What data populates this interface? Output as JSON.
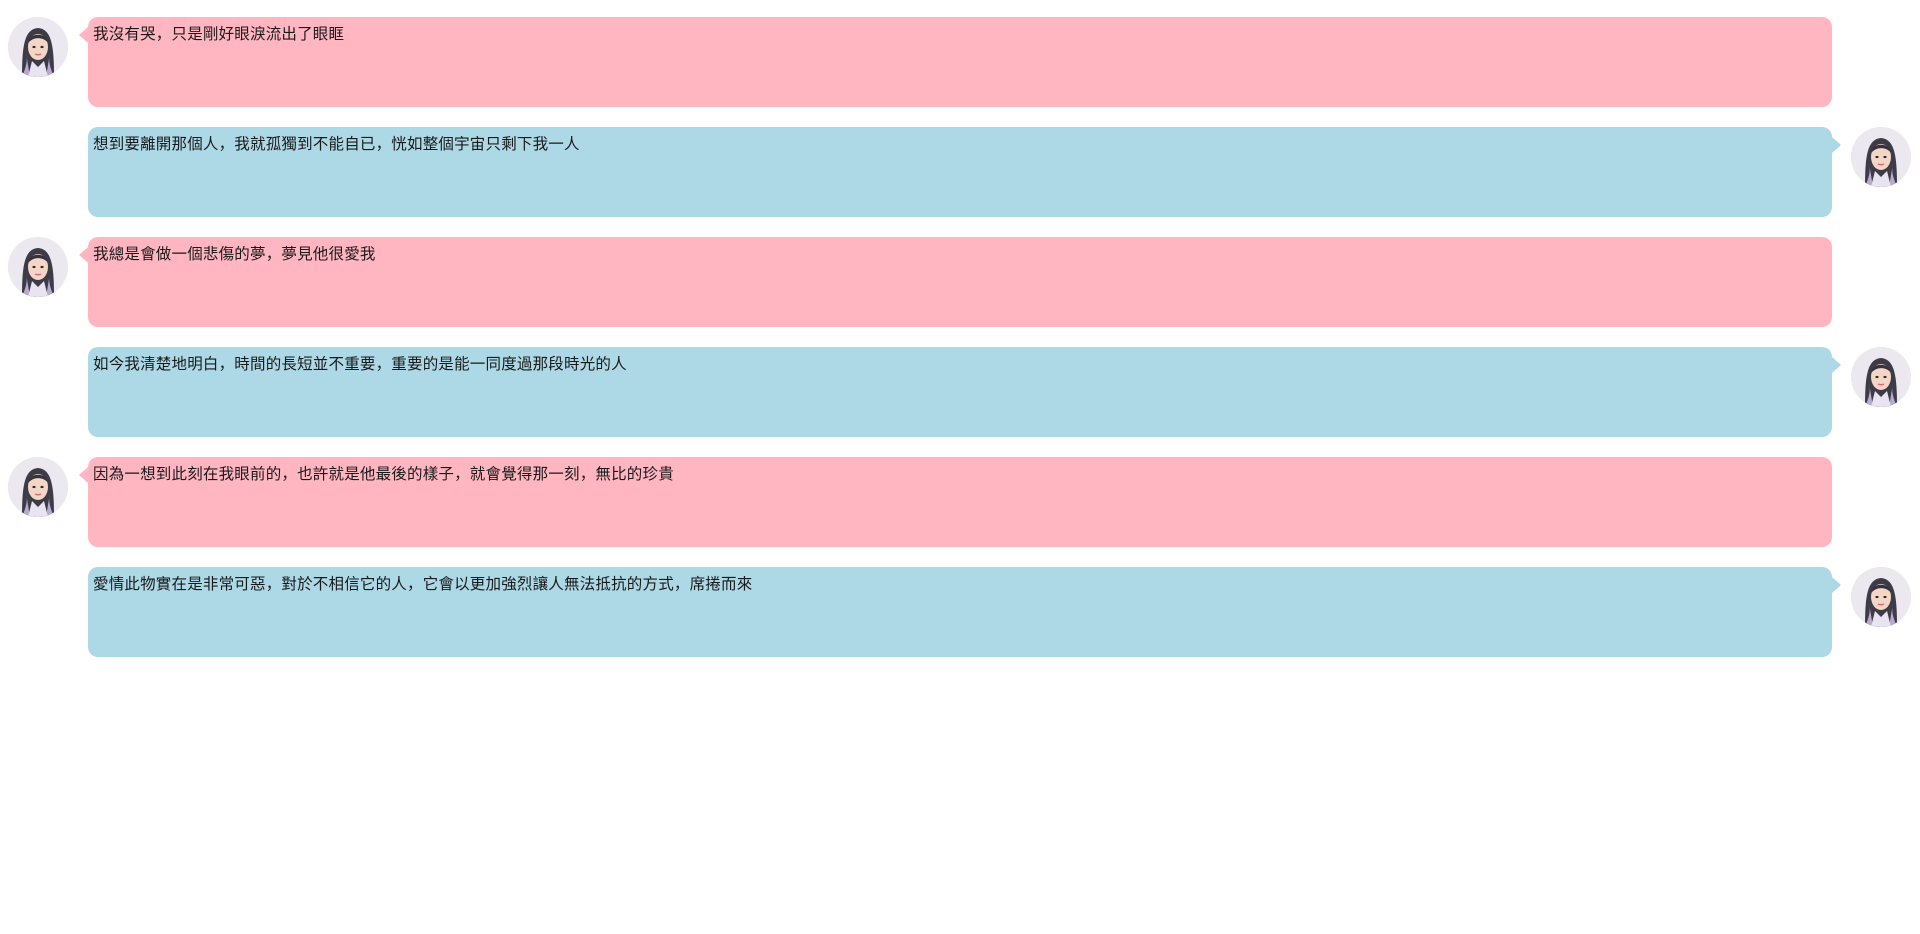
{
  "messages": [
    {
      "side": "left",
      "text": "我沒有哭，只是剛好眼淚流出了眼眶"
    },
    {
      "side": "right",
      "text": "想到要離開那個人，我就孤獨到不能自已，恍如整個宇宙只剩下我一人"
    },
    {
      "side": "left",
      "text": "我總是會做一個悲傷的夢，夢見他很愛我"
    },
    {
      "side": "right",
      "text": "如今我清楚地明白，時間的長短並不重要，重要的是能一同度過那段時光的人"
    },
    {
      "side": "left",
      "text": "因為一想到此刻在我眼前的，也許就是他最後的樣子，就會覺得那一刻，無比的珍貴"
    },
    {
      "side": "right",
      "text": "愛情此物實在是非常可惡，對於不相信它的人，它會以更加強烈讓人無法抵抗的方式，席捲而來"
    }
  ],
  "colors": {
    "left_bubble": "#ffb6c1",
    "right_bubble": "#add8e6",
    "background": "#ffffff"
  },
  "icons": {
    "avatar": "woman-avatar-icon"
  }
}
